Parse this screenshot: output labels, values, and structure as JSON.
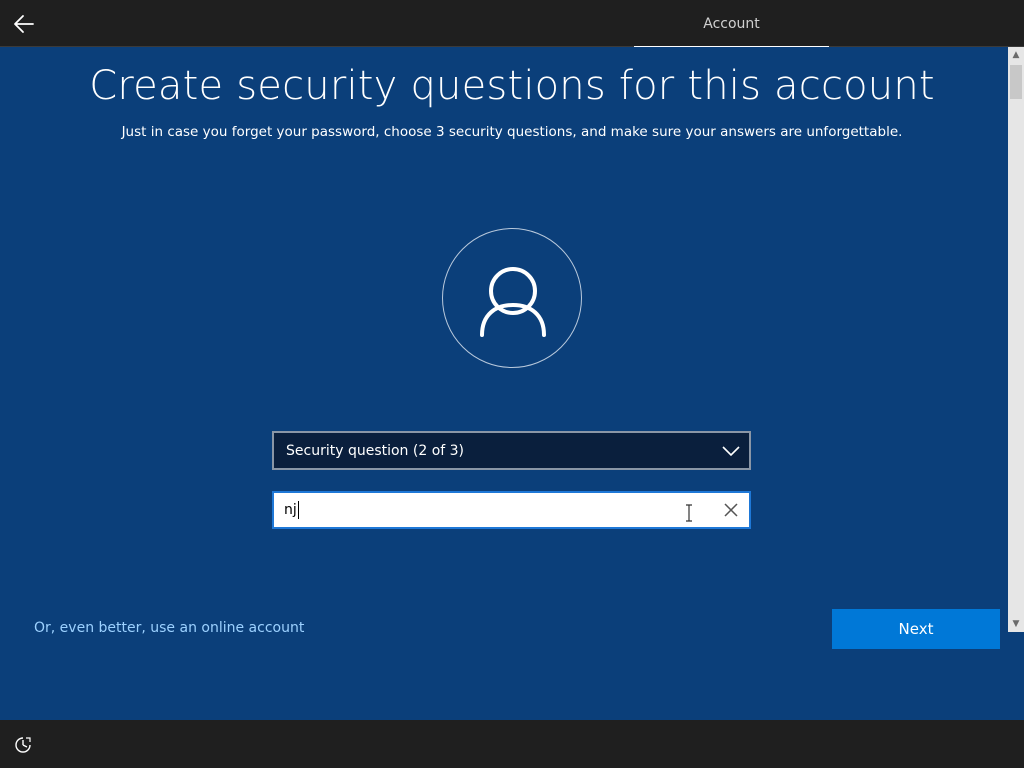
{
  "header": {
    "back_icon": "back-arrow-icon",
    "tab_label": "Account"
  },
  "main": {
    "title": "Create security questions for this account",
    "subtitle": "Just in case you forget your password, choose 3 security questions, and make sure your answers are unforgettable.",
    "avatar_icon": "user-icon",
    "security_question": {
      "selected": "Security question (2 of 3)",
      "chevron_icon": "chevron-down-icon"
    },
    "answer": {
      "value": "nj",
      "clear_icon": "close-icon"
    },
    "online_account_link": "Or, even better, use an online account",
    "next_label": "Next"
  },
  "footer": {
    "ease_icon": "ease-of-access-icon"
  },
  "colors": {
    "background": "#0b3f7a",
    "bars": "#1f1f1f",
    "accent": "#0078d7",
    "link": "#9cd1ff"
  }
}
